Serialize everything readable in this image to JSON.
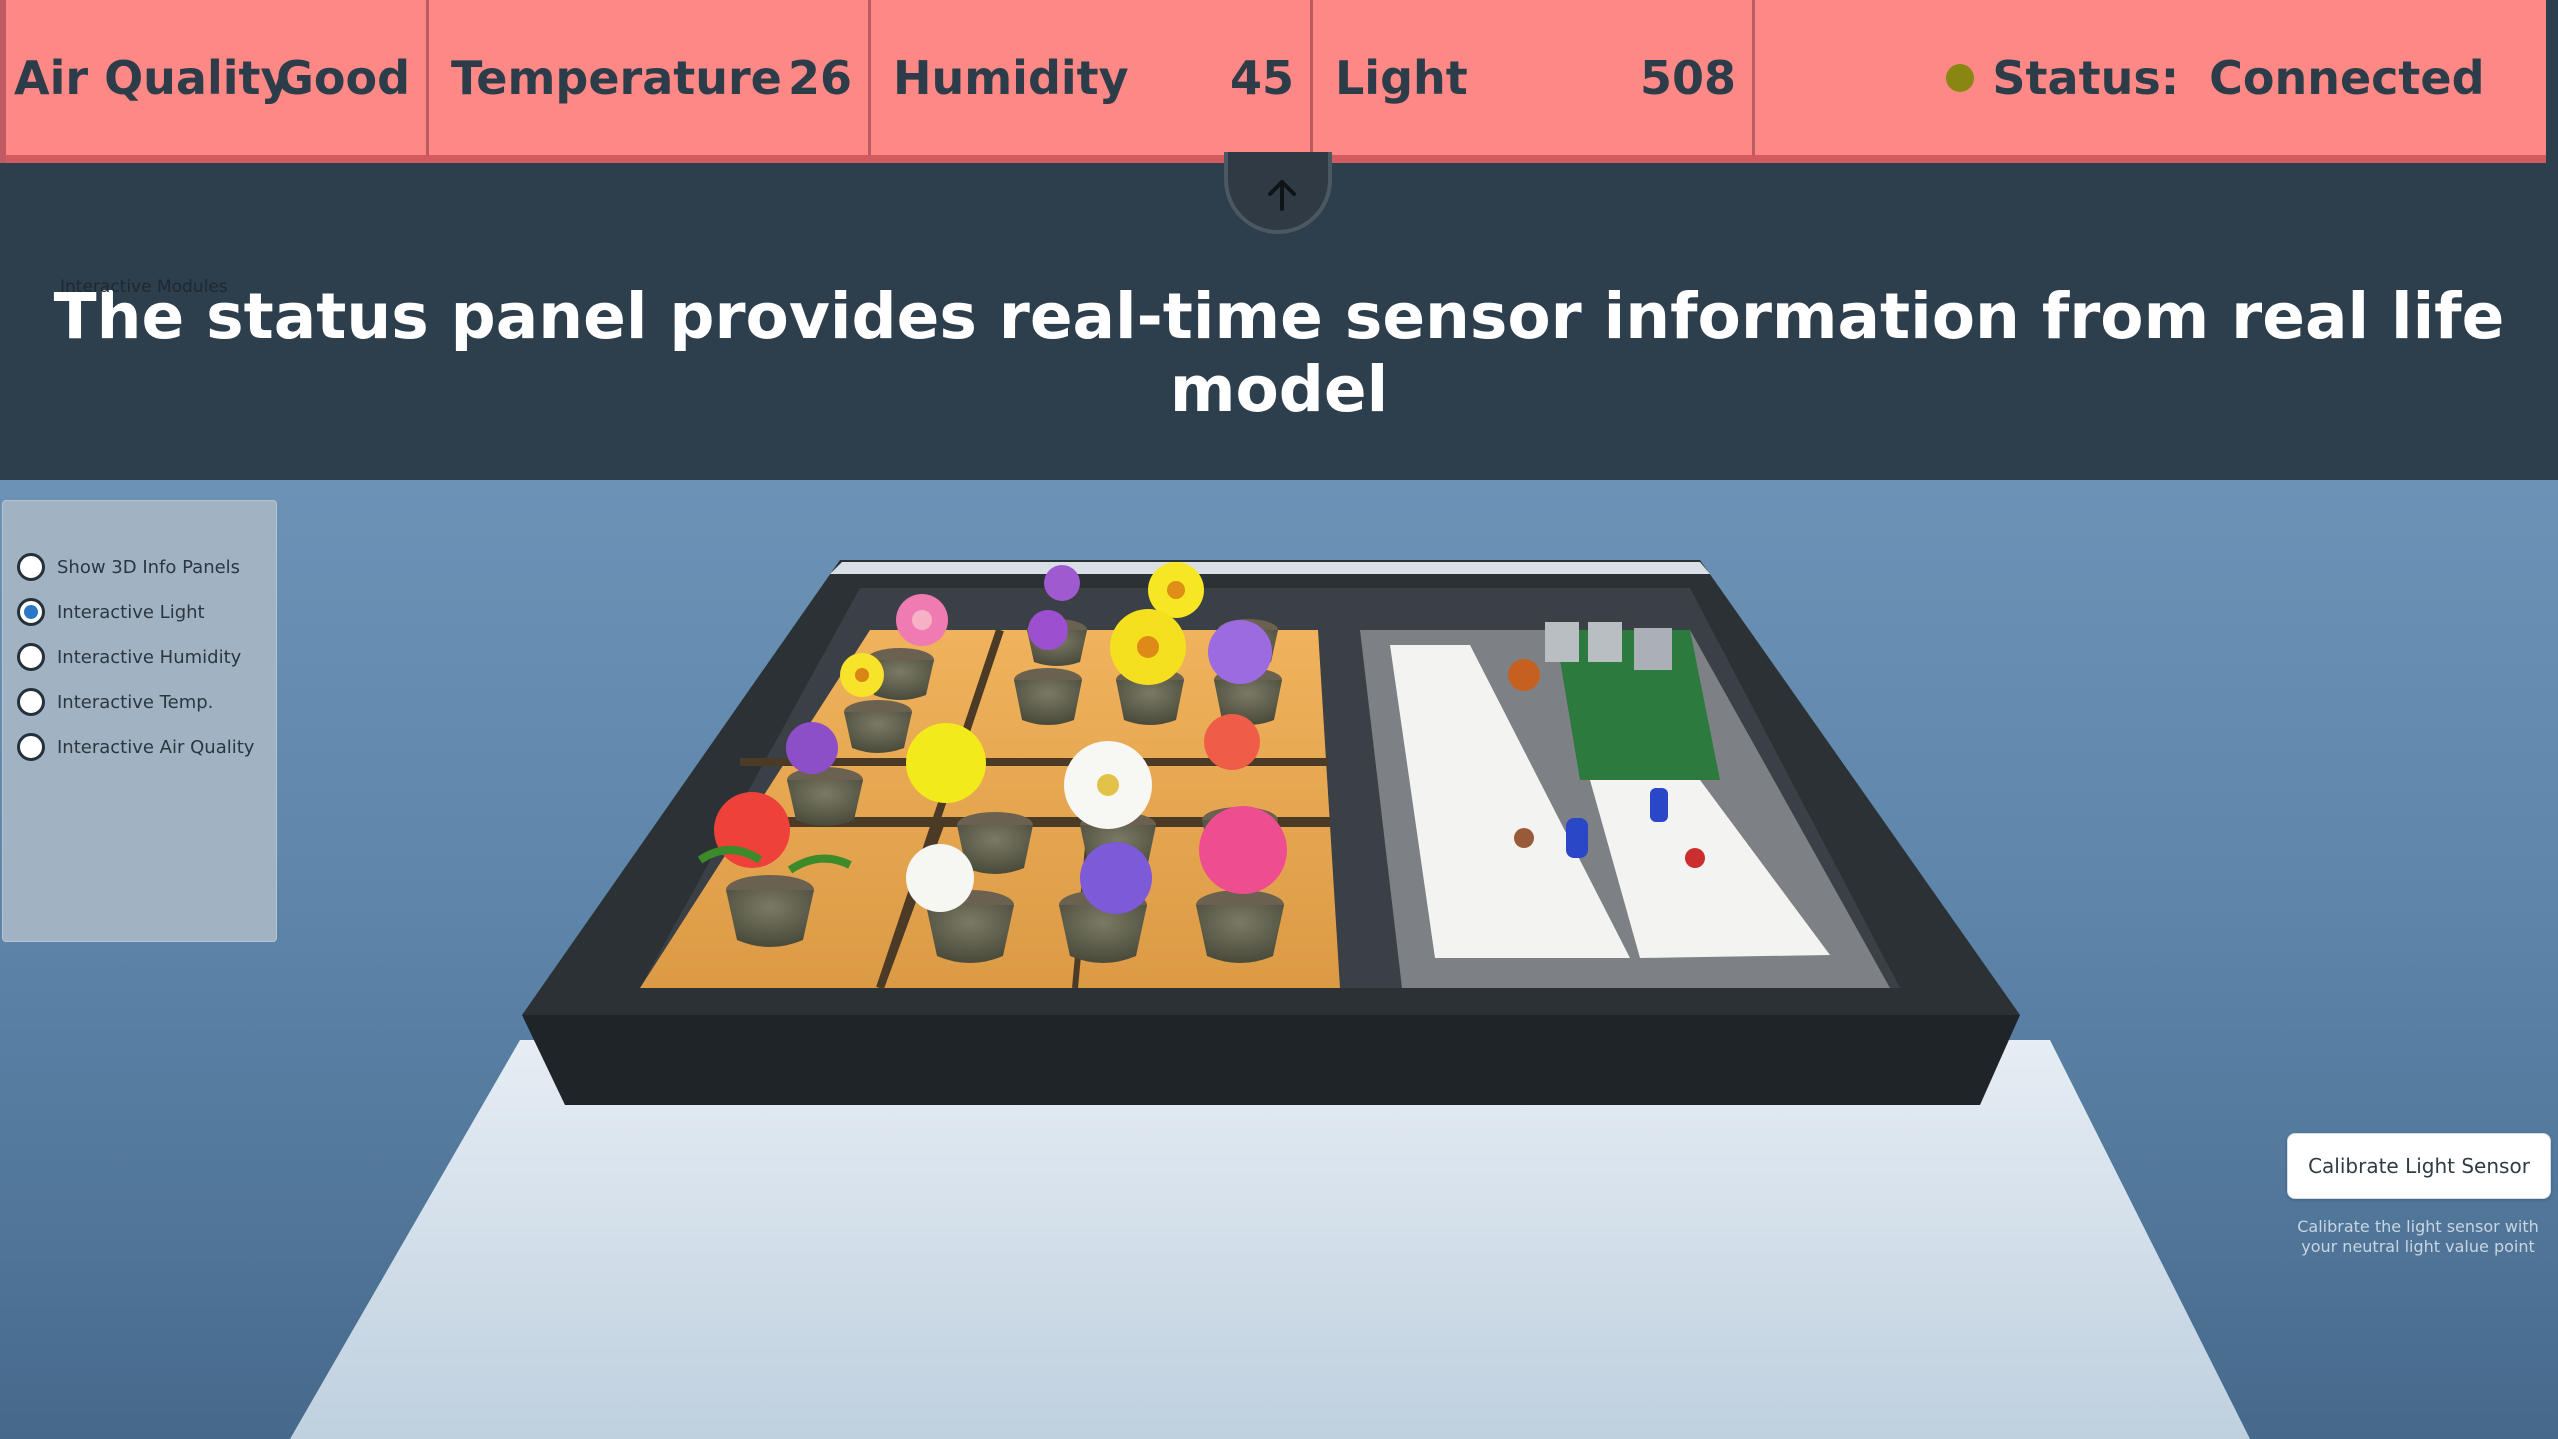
{
  "status_bar": {
    "air_quality": {
      "label": "Air Quality",
      "value": "Good"
    },
    "temperature": {
      "label": "Temperature",
      "value": "26"
    },
    "humidity": {
      "label": "Humidity",
      "value": "45"
    },
    "light": {
      "label": "Light",
      "value": "508"
    },
    "status": {
      "label": "Status:",
      "value": "Connected",
      "dot_color": "#8a8612"
    }
  },
  "collapse_tab": {
    "icon": "arrow-up-icon"
  },
  "caption": "The status panel provides real-time sensor information from real life model",
  "modules": {
    "title": "Interactive Modules",
    "options": [
      {
        "label": "Show 3D Info Panels",
        "selected": false
      },
      {
        "label": "Interactive Light",
        "selected": true
      },
      {
        "label": "Interactive Humidity",
        "selected": false
      },
      {
        "label": "Interactive Temp.",
        "selected": false
      },
      {
        "label": "Interactive Air Quality",
        "selected": false
      }
    ]
  },
  "calibrate": {
    "button_label": "Calibrate Light Sensor",
    "help_line1": "Calibrate the light sensor with",
    "help_line2": "your neutral light value point"
  },
  "colors": {
    "status_bar": "#fd8886",
    "caption_band": "#2d3e4d",
    "accent": "#2b78c8"
  }
}
